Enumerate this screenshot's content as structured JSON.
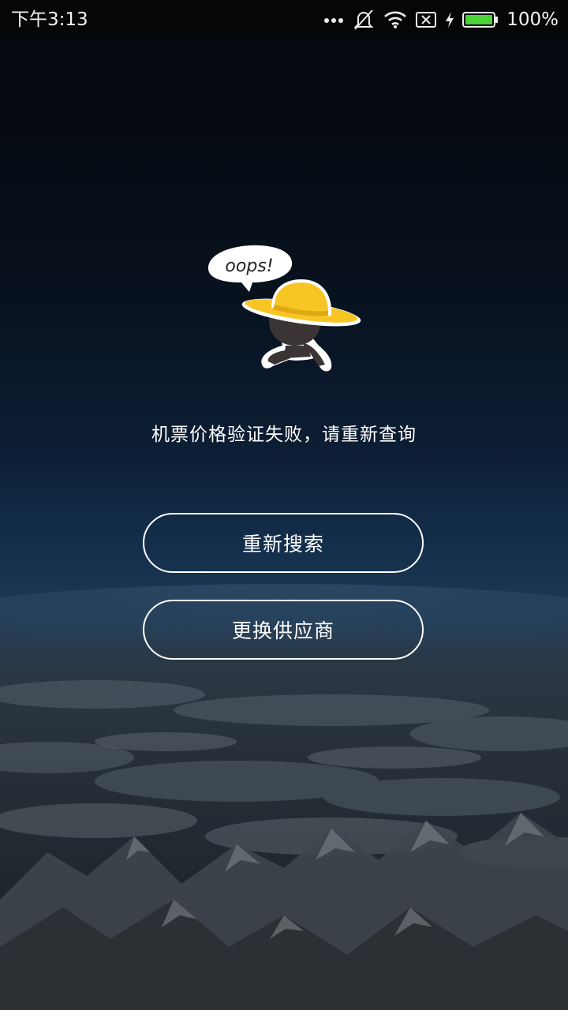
{
  "status_bar": {
    "time": "下午3:13",
    "battery": "100%",
    "icons": [
      "more-dots-icon",
      "vibrate-off-icon",
      "wifi-icon",
      "no-sim-icon",
      "charging-icon",
      "battery-icon"
    ],
    "battery_color": "#4cd137"
  },
  "mascot": {
    "speech_bubble": "oops!",
    "hat_color": "#f7c524"
  },
  "message": "机票价格验证失败，请重新查询",
  "buttons": {
    "research": "重新搜索",
    "switch_supplier": "更换供应商"
  }
}
